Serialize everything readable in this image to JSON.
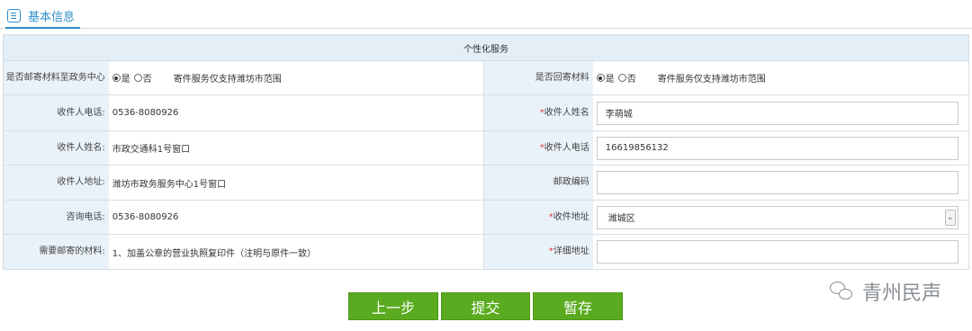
{
  "tab": {
    "icon": "list-icon",
    "label": "基本信息"
  },
  "section_title": "个性化服务",
  "left": {
    "mail_label": "是否邮寄材料至政务中心",
    "yes": "是",
    "no": "否",
    "note": "寄件服务仅支持潍坊市范围",
    "phone_label": "收件人电话:",
    "phone_value": "0536-8080926",
    "name_label": "收件人姓名:",
    "name_value": "市政交通科1号窗口",
    "address_label": "收件人地址:",
    "address_value": "潍坊市政务服务中心1号窗口",
    "consult_label": "咨询电话:",
    "consult_value": "0536-8080926",
    "materials_label": "需要邮寄的材料:",
    "materials_value": "1、加盖公章的营业执照复印件（注明与原件一致）"
  },
  "right": {
    "return_label": "是否回寄材料",
    "yes": "是",
    "no": "否",
    "note": "寄件服务仅支持潍坊市范围",
    "required_mark": "*",
    "recv_name_label": "收件人姓名",
    "recv_name_value": "李萌城",
    "recv_phone_label": "收件人电话",
    "recv_phone_value": "16619856132",
    "postcode_label": "邮政编码",
    "postcode_value": "",
    "recv_addr_label": "收件地址",
    "recv_addr_value": "潍城区",
    "detail_addr_label": "详细地址",
    "detail_addr_value": ""
  },
  "buttons": {
    "prev": "上一步",
    "submit": "提交",
    "save": "暂存"
  },
  "watermark": {
    "icon": "wechat-icon",
    "text": "青州民声"
  },
  "colors": {
    "accent": "#2e8ec8",
    "button_green": "#5aab1f",
    "label_bg": "#e9f2f9",
    "required": "#e53935"
  }
}
